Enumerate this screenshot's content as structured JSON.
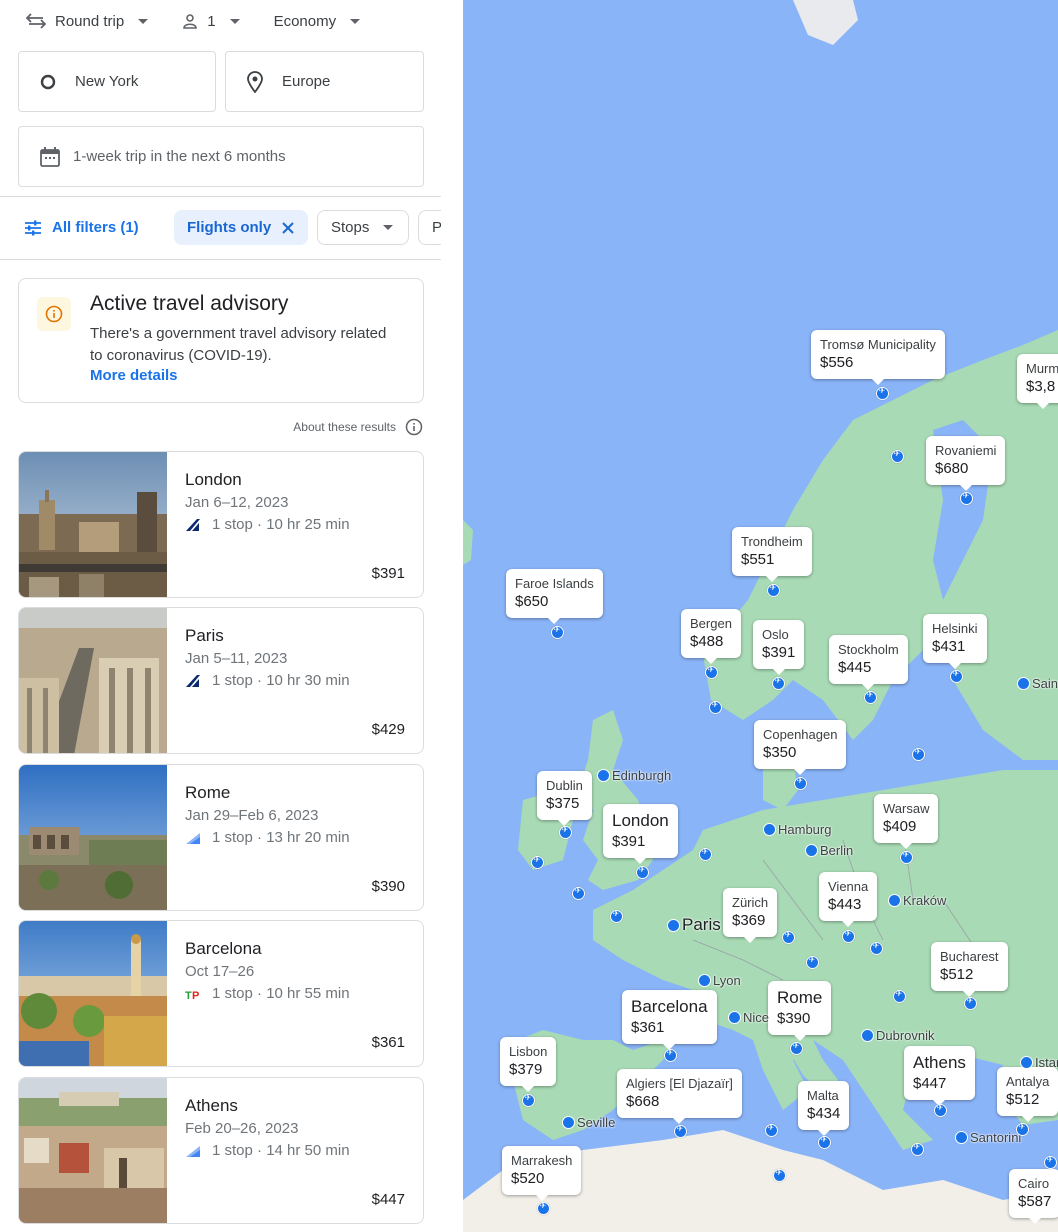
{
  "search": {
    "trip_type": "Round trip",
    "passengers": "1",
    "cabin": "Economy",
    "origin": "New York",
    "destination": "Europe",
    "dates": "1-week trip in the next 6 months"
  },
  "filters": {
    "all_filters": "All filters (1)",
    "flights_only": "Flights only",
    "stops": "Stops",
    "price_partial": "Pr"
  },
  "advisory": {
    "title": "Active travel advisory",
    "text": "There's a government travel advisory related to coronavirus (COVID-19).",
    "link": "More details"
  },
  "about_results": "About these results",
  "results": [
    {
      "city": "London",
      "dates": "Jan 6–12, 2023",
      "stops": "1 stop · 10 hr 25 min",
      "price": "$391"
    },
    {
      "city": "Paris",
      "dates": "Jan 5–11, 2023",
      "stops": "1 stop · 10 hr 30 min",
      "price": "$429"
    },
    {
      "city": "Rome",
      "dates": "Jan 29–Feb 6, 2023",
      "stops": "1 stop · 13 hr 20 min",
      "price": "$390"
    },
    {
      "city": "Barcelona",
      "dates": "Oct 17–26",
      "stops": "1 stop · 10 hr 55 min",
      "price": "$361"
    },
    {
      "city": "Athens",
      "dates": "Feb 20–26, 2023",
      "stops": "1 stop · 14 hr 50 min",
      "price": "$447"
    }
  ],
  "map_bubbles": [
    {
      "name": "Tromsø Municipality",
      "price": "$556"
    },
    {
      "name": "Murm",
      "price": "$3,8"
    },
    {
      "name": "Rovaniemi",
      "price": "$680"
    },
    {
      "name": "Trondheim",
      "price": "$551"
    },
    {
      "name": "Faroe Islands",
      "price": "$650"
    },
    {
      "name": "Bergen",
      "price": "$488"
    },
    {
      "name": "Oslo",
      "price": "$391"
    },
    {
      "name": "Stockholm",
      "price": "$445"
    },
    {
      "name": "Helsinki",
      "price": "$431"
    },
    {
      "name": "Copenhagen",
      "price": "$350"
    },
    {
      "name": "Dublin",
      "price": "$375"
    },
    {
      "name": "London",
      "price": "$391"
    },
    {
      "name": "Warsaw",
      "price": "$409"
    },
    {
      "name": "Zürich",
      "price": "$369"
    },
    {
      "name": "Vienna",
      "price": "$443"
    },
    {
      "name": "Bucharest",
      "price": "$512"
    },
    {
      "name": "Barcelona",
      "price": "$361"
    },
    {
      "name": "Rome",
      "price": "$390"
    },
    {
      "name": "Lisbon",
      "price": "$379"
    },
    {
      "name": "Athens",
      "price": "$447"
    },
    {
      "name": "Antalya",
      "price": "$512"
    },
    {
      "name": "Algiers [El Djazaïr]",
      "price": "$668"
    },
    {
      "name": "Malta",
      "price": "$434"
    },
    {
      "name": "Marrakesh",
      "price": "$520"
    },
    {
      "name": "Cairo",
      "price": "$587"
    }
  ],
  "map_labels": [
    "Edinburgh",
    "Hamburg",
    "Berlin",
    "Paris",
    "Kraków",
    "Lyon",
    "Nice",
    "Dubrovnik",
    "Seville",
    "Santorini",
    "Istanb",
    "Sain"
  ],
  "colors": {
    "accent": "#1a73e8",
    "water": "#8ab4f8",
    "land": "#a8dab5"
  }
}
